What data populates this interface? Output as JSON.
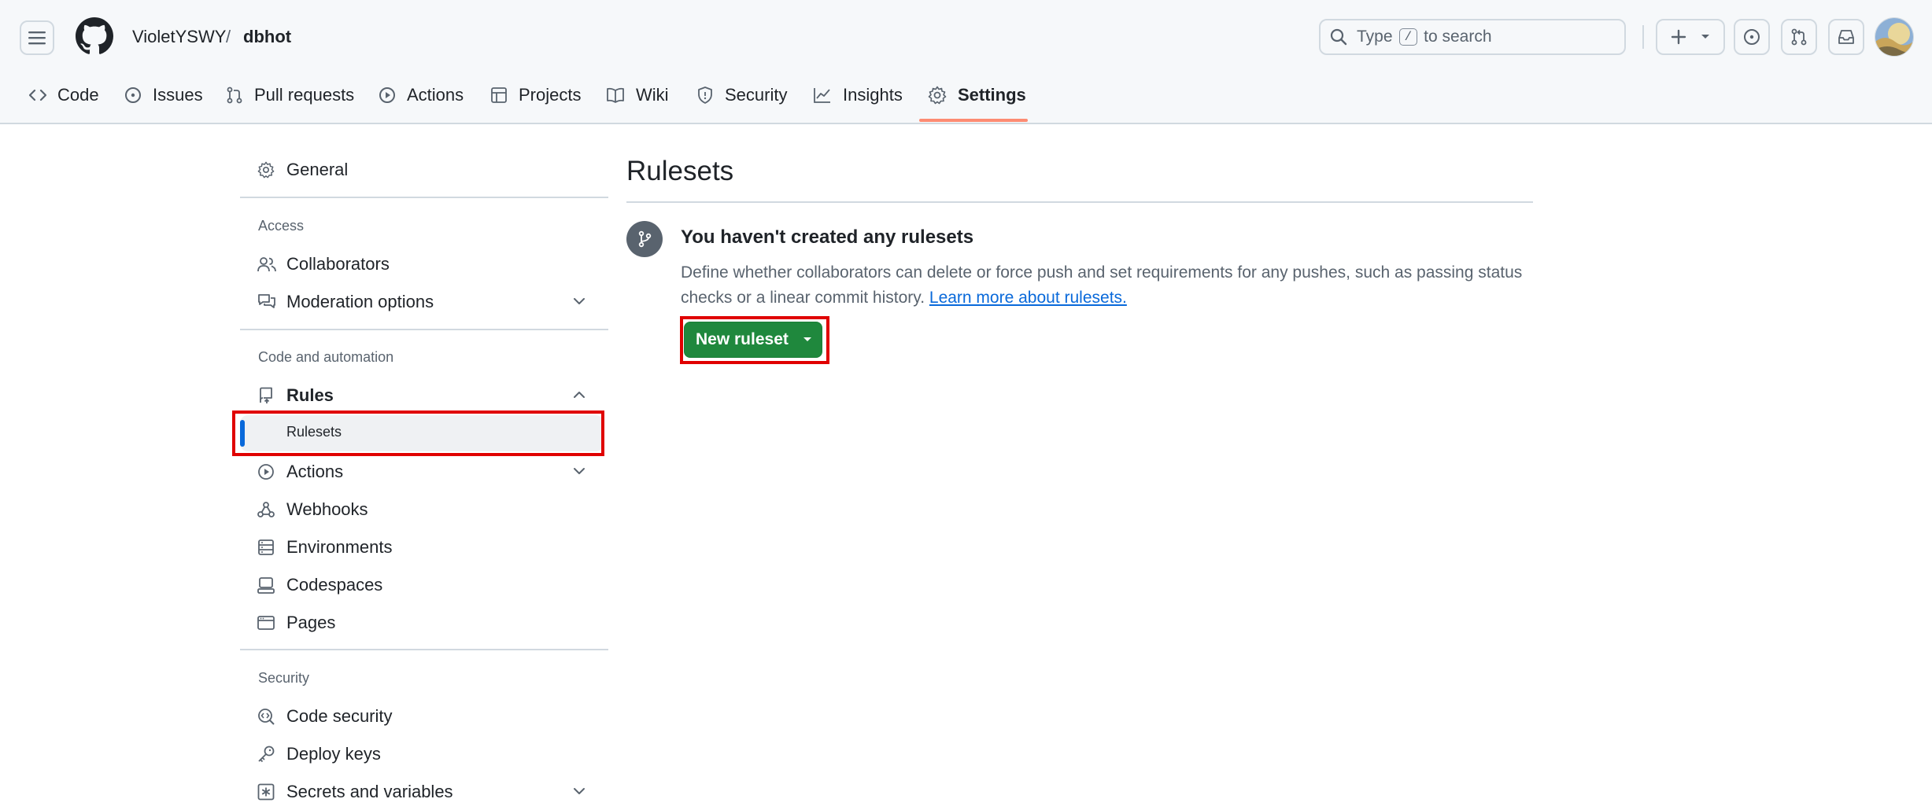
{
  "header": {
    "owner": "VioletYSWY",
    "separator": "/",
    "repo": "dbhot",
    "search": {
      "prefix": "Type",
      "key": "/",
      "suffix": "to search"
    }
  },
  "repo_nav": [
    {
      "label": "Code",
      "icon": "code-icon"
    },
    {
      "label": "Issues",
      "icon": "issue-opened-icon"
    },
    {
      "label": "Pull requests",
      "icon": "git-pull-request-icon"
    },
    {
      "label": "Actions",
      "icon": "play-icon"
    },
    {
      "label": "Projects",
      "icon": "table-icon"
    },
    {
      "label": "Wiki",
      "icon": "book-icon"
    },
    {
      "label": "Security",
      "icon": "shield-icon"
    },
    {
      "label": "Insights",
      "icon": "graph-icon"
    },
    {
      "label": "Settings",
      "icon": "gear-icon",
      "selected": true
    }
  ],
  "sidebar": {
    "general": "General",
    "sections": {
      "access": "Access",
      "code_automation": "Code and automation",
      "security": "Security"
    },
    "items": {
      "collaborators": "Collaborators",
      "moderation": "Moderation options",
      "rules": "Rules",
      "rulesets": "Rulesets",
      "actions": "Actions",
      "webhooks": "Webhooks",
      "environments": "Environments",
      "codespaces": "Codespaces",
      "pages": "Pages",
      "code_security": "Code security",
      "deploy_keys": "Deploy keys",
      "secrets": "Secrets and variables"
    }
  },
  "main": {
    "title": "Rulesets",
    "blankslate": {
      "heading": "You haven't created any rulesets",
      "description": "Define whether collaborators can delete or force push and set requirements for any pushes, such as passing status checks or a linear commit history.",
      "link": "Learn more about rulesets.",
      "button": "New ruleset"
    }
  },
  "colors": {
    "accent": "#0969da",
    "primary_button": "#1f883d",
    "selected_tab_underline": "#fd8c73",
    "annotation_box": "#e00000"
  }
}
